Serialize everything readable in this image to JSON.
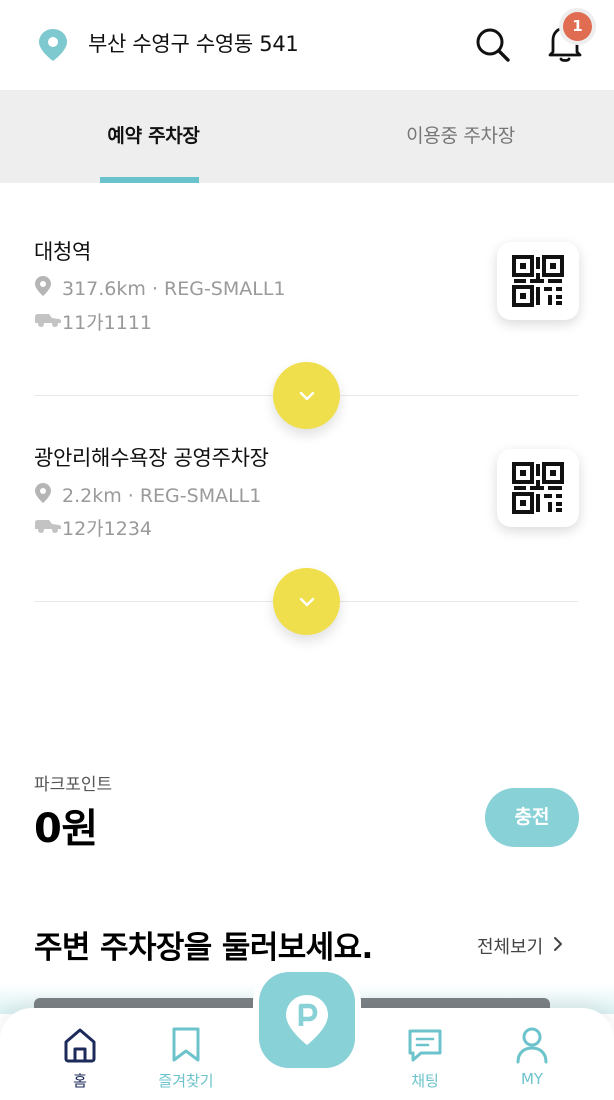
{
  "header": {
    "location": "부산 수영구 수영동 541",
    "notification_count": "1"
  },
  "tabs": {
    "active": "예약 주차장",
    "inactive": "이용중 주차장"
  },
  "reservations": [
    {
      "name": "대청역",
      "distance_info": "317.6km · REG-SMALL1",
      "plate": "11가1111"
    },
    {
      "name": "광안리해수욕장 공영주차장",
      "distance_info": "2.2km · REG-SMALL1",
      "plate": "12가1234"
    }
  ],
  "park_point": {
    "label": "파크포인트",
    "value": "0원",
    "charge_label": "충전"
  },
  "nearby": {
    "title": "주변 주차장을 둘러보세요.",
    "see_all": "전체보기"
  },
  "bottom_nav": {
    "home": "홈",
    "favorites": "즐겨찾기",
    "chat": "채팅",
    "my": "MY"
  },
  "colors": {
    "accent_mint": "#88d1d7",
    "accent_yellow": "#f0df4c",
    "badge_red": "#e06c52",
    "nav_active": "#1c2a5a"
  }
}
